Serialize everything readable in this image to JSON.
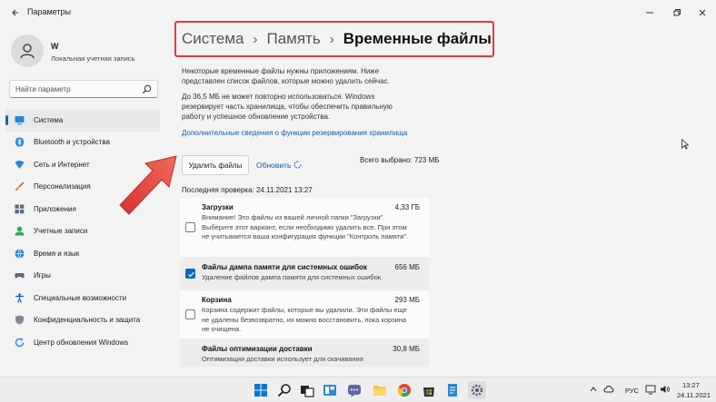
{
  "window": {
    "title": "Параметры"
  },
  "profile": {
    "name": "W",
    "subtitle": "Локальная учетная запись"
  },
  "search": {
    "placeholder": "Найти параметр"
  },
  "sidebar": {
    "items": [
      {
        "label": "Система",
        "icon": "system-icon",
        "active": true
      },
      {
        "label": "Bluetooth и устройства",
        "icon": "bluetooth-icon"
      },
      {
        "label": "Сеть и Интернет",
        "icon": "network-icon"
      },
      {
        "label": "Персонализация",
        "icon": "brush-icon"
      },
      {
        "label": "Приложения",
        "icon": "apps-icon"
      },
      {
        "label": "Учетные записи",
        "icon": "account-icon"
      },
      {
        "label": "Время и язык",
        "icon": "globe-icon"
      },
      {
        "label": "Игры",
        "icon": "gamepad-icon"
      },
      {
        "label": "Специальные возможности",
        "icon": "accessibility-icon"
      },
      {
        "label": "Конфиденциальность и защита",
        "icon": "shield-icon"
      },
      {
        "label": "Центр обновления Windows",
        "icon": "update-icon"
      }
    ]
  },
  "breadcrumb": {
    "level1": "Система",
    "level2": "Память",
    "current": "Временные файлы",
    "separator": "›"
  },
  "content": {
    "intro": "Некоторые временные файлы нужны приложениям. Ниже представлен список файлов, которые можно удалить сейчас.",
    "reserve": "До 36,5 МБ не может повторно использоваться. Windows резервирует часть хранилища, чтобы обеспечить правильную работу и успешное обновление устройства.",
    "link": "Дополнительные сведения о функции резервирования хранилища",
    "delete_button": "Удалить файлы",
    "refresh": "Обновить",
    "total_selected": "Всего выбрано: 723 МБ",
    "last_check": "Последняя проверка: 24.11.2021 13:27"
  },
  "files": [
    {
      "title": "Загрузки",
      "size": "4,33 ГБ",
      "checked": false,
      "desc": "Внимание! Это файлы из вашей личной папки \"Загрузки\". Выберите этот вариант, если необходимо удалить все. При этом не учитывается ваша конфигурация функции \"Контроль памяти\"."
    },
    {
      "title": "Файлы дампа памяти для системных ошибок",
      "size": "656 МБ",
      "checked": true,
      "desc": "Удаление файлов дампа памяти для системных ошибок."
    },
    {
      "title": "Корзина",
      "size": "293 МБ",
      "checked": false,
      "desc": "Корзина содержит файлы, которые вы удалили. Эти файлы еще не удалены безвозвратно, их можно восстановить, пока корзина не очищена."
    },
    {
      "title": "Файлы оптимизации доставки",
      "size": "30,8 МБ",
      "checked": false,
      "desc": "Оптимизация доставки использует для скачивания"
    }
  ],
  "taskbar": {
    "language": "РУС",
    "time": "13:27",
    "date": "24.11.2021"
  },
  "colors": {
    "accent": "#0067c0",
    "highlight_box": "#e53b3b",
    "arrow": "#e94545"
  }
}
